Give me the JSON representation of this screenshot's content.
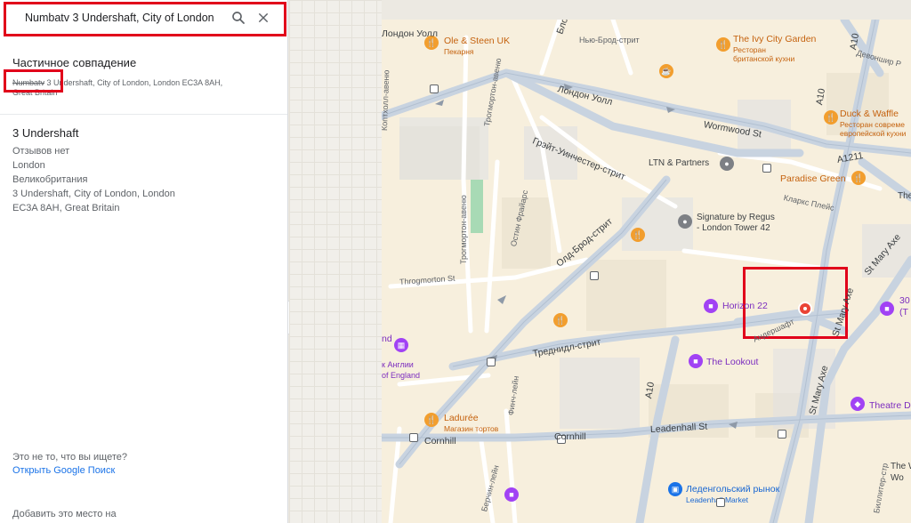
{
  "search": {
    "value": "Numbatv 3 Undershaft, City of London",
    "search_icon": "search-icon",
    "clear_icon": "close-icon"
  },
  "partial": {
    "title": "Частичное совпадение",
    "strike": "Numbatv",
    "address_line1": "3 Undershaft, City of London, London EC3A 8AH,",
    "address_line2": "Great Britain"
  },
  "place": {
    "title": "3 Undershaft",
    "reviews": "Отзывов нет",
    "city": "London",
    "country": "Великобритания",
    "addr1": "3 Undershaft, City of London, London",
    "addr2": "EC3A 8AH, Great Britain"
  },
  "footer": {
    "not_it": "Это не то, что вы ищете?",
    "google_search": "Открыть Google Поиск",
    "add_place": "Добавить это место на"
  },
  "map": {
    "places": {
      "ole_steen": "Ole & Steen UK",
      "ole_steen_sub": "Пекарня",
      "ivy": "The Ivy City Garden",
      "ivy_sub1": "Ресторан",
      "ivy_sub2": "британской кухни",
      "duck": "Duck & Waffle",
      "duck_sub1": "Ресторан совреме",
      "duck_sub2": "европейской кухни",
      "ltn": "LTN & Partners",
      "paradise": "Paradise Green",
      "regus1": "Signature by Regus",
      "regus2": "- London Tower 42",
      "horizon": "Horizon 22",
      "lookout": "The Lookout",
      "laduree": "Ladurée",
      "laduree_sub": "Магазин тортов",
      "leadenhall": "Леденгольский рынок",
      "leadenhall_sub": "Leadenhall Market",
      "theatre": "Theatre D",
      "num30": "30",
      "num30b": "(Т",
      "boe1": "nd",
      "boe2": "к Англии",
      "boe3": "of England",
      "the_w": "The W",
      "wo": "Wo",
      "the_right": "The"
    },
    "streets": {
      "london_wall_top": "Лондон Уолл",
      "london_wall": "Лондон Уолл",
      "newbroad": "Нью-Брод-стрит",
      "blomfield": "Блом",
      "wormwood": "Wormwood St",
      "great_winchester": "Грэйт-Уинчестер-стрит",
      "throgmorton_av": "Трогмортон-авеню",
      "throgmorton_av2": "Трогмортон-авеню",
      "throgmorton_st": "Throgmorton St",
      "copthall": "Коптхолл-авеню",
      "austin_friars": "Остин Фрайарс",
      "old_broad": "Олд-Брод-стрит",
      "threadneedle": "Треднидл-стрит",
      "cornhill": "Cornhill",
      "cornhill2": "Cornhill",
      "leadenhall_st": "Leadenhall St",
      "finch": "Финч-лейн",
      "birchin": "Берчин-лейн",
      "clarks": "Кларкс Плейс",
      "st_mary_axe": "St Mary Axe",
      "st_mary_axe2": "St Mary Axe",
      "st_mary_axe3": "St Mary Axe",
      "undershaft": "Андершафт",
      "billiter": "Биллитер-стр",
      "devonshire": "Девоншир Р",
      "a10a": "A10",
      "a10b": "A10",
      "a10c": "A10",
      "a1211": "A1211"
    }
  },
  "colors": {
    "highlight": "#e1001a",
    "link": "#1a73e8",
    "map_base": "#f7efdd"
  }
}
